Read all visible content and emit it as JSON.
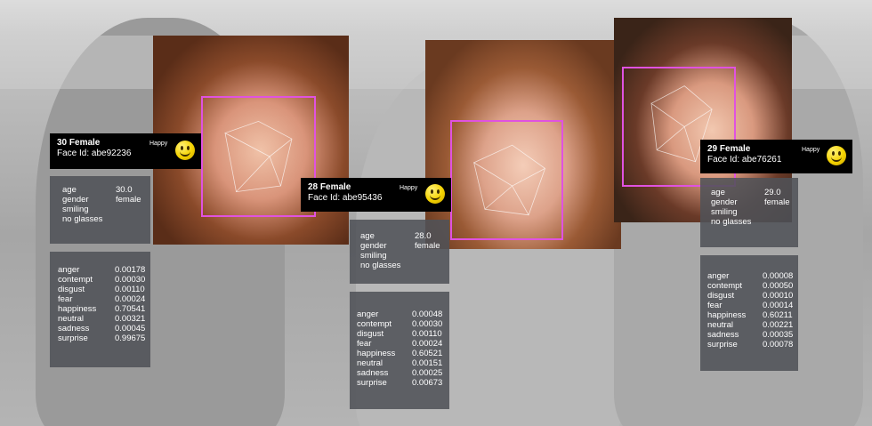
{
  "faces": [
    {
      "title": "30 Female",
      "face_id": "Face Id: abe92236",
      "emotion": "Happy",
      "attributes": [
        {
          "key": "age",
          "value": "30.0"
        },
        {
          "key": "gender",
          "value": "female"
        },
        {
          "key": "smiling",
          "value": ""
        },
        {
          "key": "no glasses",
          "value": ""
        }
      ],
      "emotions": [
        {
          "key": "anger",
          "value": "0.00178"
        },
        {
          "key": "contempt",
          "value": "0.00030"
        },
        {
          "key": "disgust",
          "value": "0.00110"
        },
        {
          "key": "fear",
          "value": "0.00024"
        },
        {
          "key": "happiness",
          "value": "0.70541"
        },
        {
          "key": "neutral",
          "value": "0.00321"
        },
        {
          "key": "sadness",
          "value": "0.00045"
        },
        {
          "key": "surprise",
          "value": "0.99675"
        }
      ]
    },
    {
      "title": "28 Female",
      "face_id": "Face Id: abe95436",
      "emotion": "Happy",
      "attributes": [
        {
          "key": "age",
          "value": "28.0"
        },
        {
          "key": "gender",
          "value": "female"
        },
        {
          "key": "smiling",
          "value": ""
        },
        {
          "key": "no glasses",
          "value": ""
        }
      ],
      "emotions": [
        {
          "key": "anger",
          "value": "0.00048"
        },
        {
          "key": "contempt",
          "value": "0.00030"
        },
        {
          "key": "disgust",
          "value": "0.00110"
        },
        {
          "key": "fear",
          "value": "0.00024"
        },
        {
          "key": "happiness",
          "value": "0.60521"
        },
        {
          "key": "neutral",
          "value": "0.00151"
        },
        {
          "key": "sadness",
          "value": "0.00025"
        },
        {
          "key": "surprise",
          "value": "0.00673"
        }
      ]
    },
    {
      "title": "29 Female",
      "face_id": "Face Id: abe76261",
      "emotion": "Happy",
      "attributes": [
        {
          "key": "age",
          "value": "29.0"
        },
        {
          "key": "gender",
          "value": "female"
        },
        {
          "key": "smiling",
          "value": ""
        },
        {
          "key": "no glasses",
          "value": ""
        }
      ],
      "emotions": [
        {
          "key": "anger",
          "value": "0.00008"
        },
        {
          "key": "contempt",
          "value": "0.00050"
        },
        {
          "key": "disgust",
          "value": "0.00010"
        },
        {
          "key": "fear",
          "value": "0.00014"
        },
        {
          "key": "happiness",
          "value": "0.60211"
        },
        {
          "key": "neutral",
          "value": "0.00221"
        },
        {
          "key": "sadness",
          "value": "0.00035"
        },
        {
          "key": "surprise",
          "value": "0.00078"
        }
      ]
    }
  ],
  "colors": {
    "face_box": "#e052e0",
    "header_bg": "#000000",
    "panel_bg": "#505258",
    "emoji": "#f4d200"
  },
  "icons": {
    "emotion": "smiley-face-icon"
  }
}
